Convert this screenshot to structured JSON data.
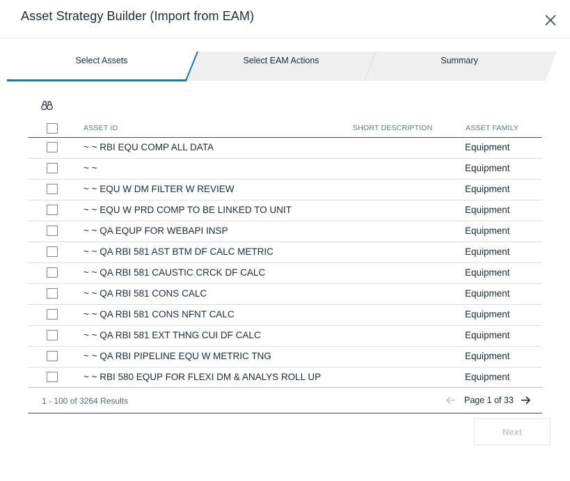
{
  "dialog": {
    "title": "Asset Strategy Builder (Import from EAM)"
  },
  "icons": {
    "close": "close-icon",
    "search": "binoculars-icon",
    "prev": "arrow-left-icon",
    "next": "arrow-right-icon"
  },
  "stepper": {
    "steps": [
      {
        "label": "Select Assets",
        "active": true
      },
      {
        "label": "Select EAM Actions",
        "active": false
      },
      {
        "label": "Summary",
        "active": false
      }
    ]
  },
  "colors": {
    "accent": "#1b7aa0",
    "inactive_step": "#efefef",
    "text": "#1d2b36",
    "header_text": "#5b7a8c"
  },
  "grid": {
    "columns": {
      "asset_id": "ASSET ID",
      "short_description": "SHORT DESCRIPTION",
      "asset_family": "ASSET FAMILY"
    },
    "rows": [
      {
        "asset_id": "~ ~ RBI EQU COMP ALL DATA",
        "asset_family": "Equipment"
      },
      {
        "asset_id": "~ ~",
        "asset_family": "Equipment"
      },
      {
        "asset_id": "~ ~ EQU W DM FILTER W REVIEW",
        "asset_family": "Equipment"
      },
      {
        "asset_id": "~ ~ EQU W PRD COMP TO BE LINKED TO UNIT",
        "asset_family": "Equipment"
      },
      {
        "asset_id": "~ ~ QA EQUP FOR WEBAPI INSP",
        "asset_family": "Equipment"
      },
      {
        "asset_id": "~ ~ QA RBI 581 AST BTM DF CALC METRIC",
        "asset_family": "Equipment"
      },
      {
        "asset_id": "~ ~ QA RBI 581 CAUSTIC CRCK DF CALC",
        "asset_family": "Equipment"
      },
      {
        "asset_id": "~ ~ QA RBI 581 CONS CALC",
        "asset_family": "Equipment"
      },
      {
        "asset_id": "~ ~ QA RBI 581 CONS NFNT CALC",
        "asset_family": "Equipment"
      },
      {
        "asset_id": "~ ~ QA RBI 581 EXT THNG CUI DF CALC",
        "asset_family": "Equipment"
      },
      {
        "asset_id": "~ ~ QA RBI PIPELINE EQU W METRIC TNG",
        "asset_family": "Equipment"
      },
      {
        "asset_id": "~ ~ RBI 580 EQUP FOR FLEXI DM & ANALYS ROLL UP",
        "asset_family": "Equipment"
      }
    ]
  },
  "pagination": {
    "results": "1 - 100 of 3264 Results",
    "page_text": "Page 1 of 33"
  },
  "footer": {
    "next_label": "Next"
  }
}
